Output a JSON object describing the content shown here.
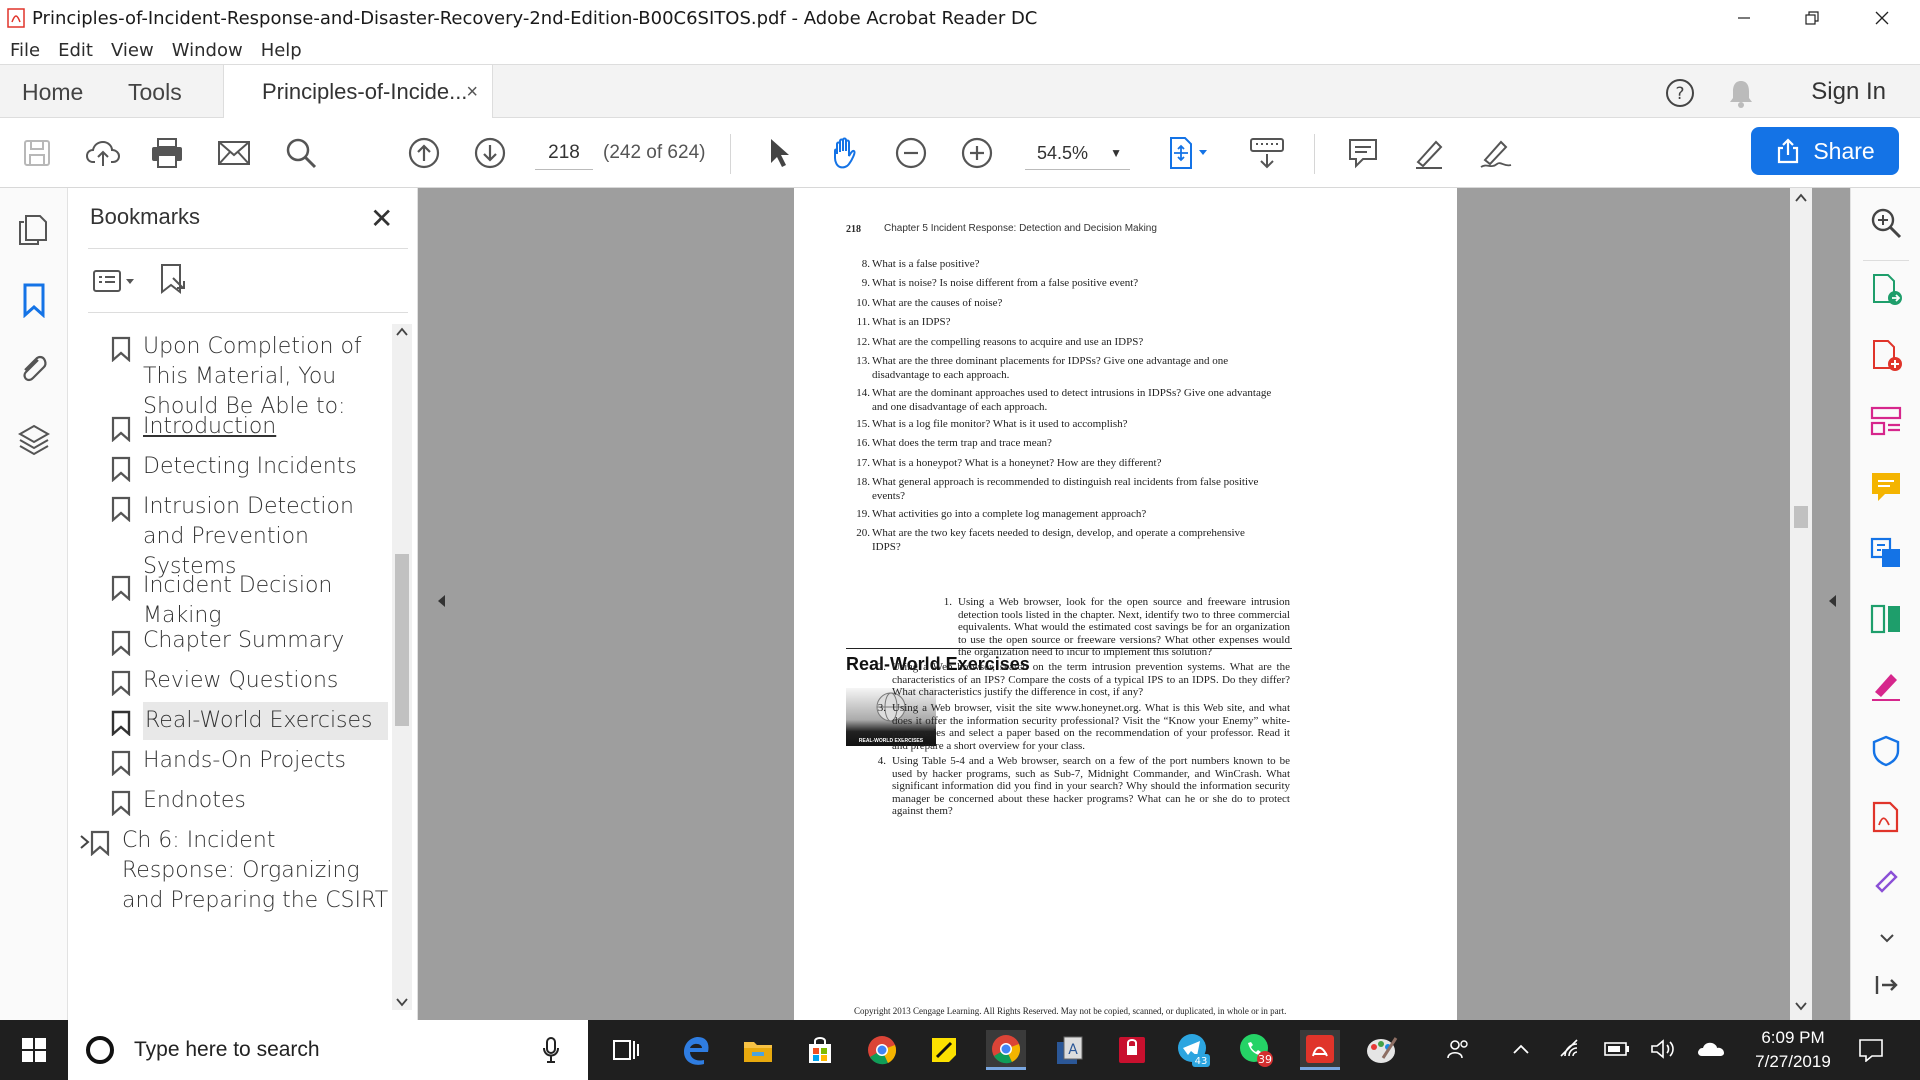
{
  "window": {
    "title": "Principles-of-Incident-Response-and-Disaster-Recovery-2nd-Edition-B00C6SITOS.pdf - Adobe Acrobat Reader DC"
  },
  "menu": [
    "File",
    "Edit",
    "View",
    "Window",
    "Help"
  ],
  "tabs": {
    "home": "Home",
    "tools": "Tools",
    "document": "Principles-of-Incide...",
    "close": "×",
    "sign_in": "Sign In"
  },
  "toolbar": {
    "page_number": "218",
    "page_of": "(242 of 624)",
    "zoom": "54.5%",
    "share": "Share"
  },
  "bookmarks": {
    "title": "Bookmarks",
    "items": [
      {
        "label": "Upon Completion of This Material, You Should Be Able to:"
      },
      {
        "label": "Introduction"
      },
      {
        "label": "Detecting Incidents"
      },
      {
        "label": "Intrusion Detection and Prevention Systems"
      },
      {
        "label": "Incident Decision Making"
      },
      {
        "label": "Chapter Summary"
      },
      {
        "label": "Review Questions"
      },
      {
        "label": "Real-World Exercises"
      },
      {
        "label": "Hands-On Projects"
      },
      {
        "label": "Endnotes"
      },
      {
        "label": "Ch 6: Incident Response: Organizing and Preparing the CSIRT"
      }
    ]
  },
  "page": {
    "number": "218",
    "chapter": "Chapter 5   Incident Response: Detection and Decision Making",
    "questions": [
      {
        "n": "8.",
        "text": "What is a false positive?"
      },
      {
        "n": "9.",
        "text": "What is noise? Is noise different from a false positive event?"
      },
      {
        "n": "10.",
        "text": "What are the causes of noise?"
      },
      {
        "n": "11.",
        "text": "What is an IDPS?"
      },
      {
        "n": "12.",
        "text": "What are the compelling reasons to acquire and use an IDPS?"
      },
      {
        "n": "13.",
        "text": "What are the three dominant placements for IDPSs? Give one advantage and one disadvantage to each approach."
      },
      {
        "n": "14.",
        "text": "What are the dominant approaches used to detect intrusions in IDPSs? Give one advantage and one disadvantage of each approach."
      },
      {
        "n": "15.",
        "text": "What is a log file monitor? What is it used to accomplish?"
      },
      {
        "n": "16.",
        "text": "What does the term trap and trace mean?"
      },
      {
        "n": "17.",
        "text": "What is a honeypot? What is a honeynet? How are they different?"
      },
      {
        "n": "18.",
        "text": "What general approach is recommended to distinguish real incidents from false positive events?"
      },
      {
        "n": "19.",
        "text": "What activities go into a complete log management approach?"
      },
      {
        "n": "20.",
        "text": "What are the two key facets needed to design, develop, and operate a comprehensive IDPS?"
      }
    ],
    "section_title": "Real-World Exercises",
    "thumb_label": "REAL-WORLD EXERCISES",
    "exercises": [
      {
        "n": "1.",
        "text": "Using a Web browser, look for the open source and freeware intrusion detection tools listed in the chapter. Next, identify two to three commercial equivalents. What would the estimated cost savings be for an organization to use the open source or freeware versions? What other expenses would the organization need to incur to implement this solution?"
      },
      {
        "n": "2.",
        "text": "Using a Web browser, search on the term intrusion prevention systems. What are the characteristics of an IPS? Compare the costs of a typical IPS to an IDPS. Do they differ? What characteristics justify the difference in cost, if any?"
      },
      {
        "n": "3.",
        "text": "Using a Web browser, visit the site www.honeynet.org. What is this Web site, and what does it offer the information security professional? Visit the “Know your Enemy” white-paper series and select a paper based on the recommendation of your professor. Read it and prepare a short overview for your class."
      },
      {
        "n": "4.",
        "text": "Using Table 5-4 and a Web browser, search on a few of the port numbers known to be used by hacker programs, such as Sub-7, Midnight Commander, and WinCrash. What significant information did you find in your search? Why should the information security manager be concerned about these hacker programs? What can he or she do to protect against them?"
      }
    ],
    "copyright": "Copyright 2013 Cengage Learning. All Rights Reserved. May not be copied, scanned, or duplicated, in whole or in part."
  },
  "taskbar": {
    "search_placeholder": "Type here to search",
    "badge_telegram": "43",
    "badge_whatsapp": "39",
    "time": "6:09 PM",
    "date": "7/27/2019"
  },
  "colors": {
    "accent": "#1473e6",
    "bookmark_icon_blue": "#1473e6",
    "pdf_red": "#e0342a",
    "taskbar": "#1f1f1f"
  }
}
